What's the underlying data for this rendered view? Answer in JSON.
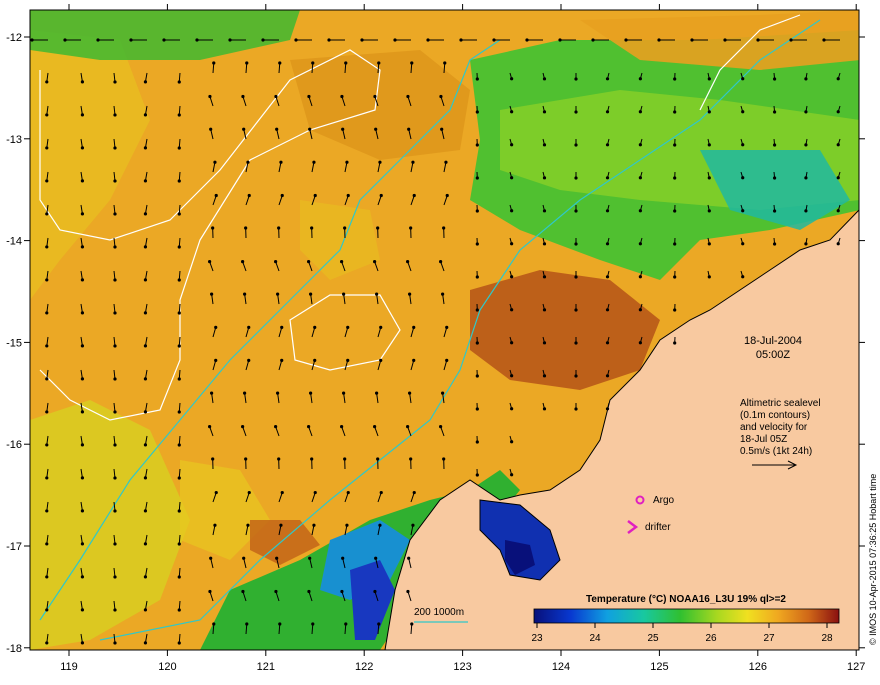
{
  "map": {
    "date": "18-Jul-2004",
    "time": "05:00Z",
    "info_lines": [
      "Altimetric sealevel",
      "(0.1m contours)",
      "and velocity for",
      "18-Jul 05Z",
      "0.5m/s (1kt 24h)"
    ],
    "legend_argo": "Argo",
    "legend_drifter": "drifter",
    "bathy_label": "200  1000m",
    "colorbar_title": "Temperature (°C) NOAA16_L3U 19% ql>=2",
    "colorbar_ticks": [
      "23",
      "24",
      "25",
      "26",
      "27",
      "28"
    ],
    "credit": "© IMOS 10-Apr-2015 07:36:25 Hobart time",
    "lon_ticks": [
      "119",
      "120",
      "121",
      "122",
      "123",
      "124",
      "125",
      "126",
      "127"
    ],
    "lat_ticks": [
      "-12",
      "-13",
      "-14",
      "-15",
      "-16",
      "-17",
      "-18"
    ],
    "colors": {
      "land": "#f8c9a0",
      "warm": "#e8a020",
      "hot": "#c06018",
      "cool": "#30b840",
      "cold": "#0818a0",
      "contour": "#ffffff",
      "bathymetry": "#30c8c8",
      "marker": "#e020c0"
    }
  }
}
